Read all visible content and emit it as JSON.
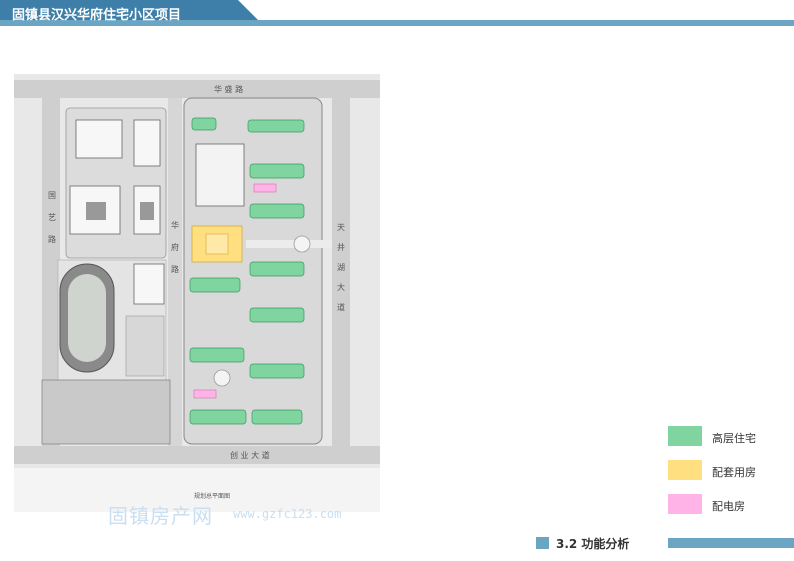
{
  "header": {
    "title": "固镇县汉兴华府住宅小区项目"
  },
  "map": {
    "roads": {
      "north": "华 盛 路",
      "west": [
        "国",
        "艺",
        "路"
      ],
      "inner": [
        "华",
        "府",
        "路"
      ],
      "east": [
        "天",
        "井",
        "湖",
        "大",
        "道"
      ],
      "south": "创 业 大 道"
    },
    "caption": "规划总平面图"
  },
  "legend": [
    {
      "label": "高层住宅",
      "color": "#7fd4a0"
    },
    {
      "label": "配套用房",
      "color": "#ffdf80"
    },
    {
      "label": "配电房",
      "color": "#ffb3e6"
    }
  ],
  "watermark": {
    "cn": "固镇房产网",
    "url": "www.gzfc123.com"
  },
  "footer": {
    "section": "3.2  功能分析"
  },
  "colors": {
    "accent": "#6aa5c4",
    "header_dark": "#3d7fa8"
  }
}
